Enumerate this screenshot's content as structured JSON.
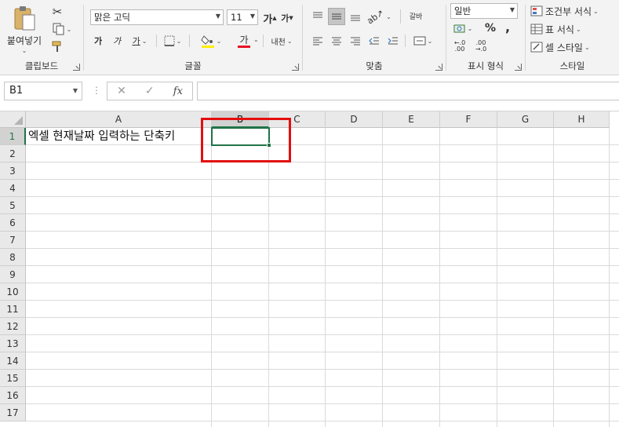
{
  "ribbon": {
    "clipboard": {
      "label": "클립보드",
      "paste_label": "붙여넣기"
    },
    "font": {
      "label": "글꼴",
      "font_name": "맑은 고딕",
      "font_size": "11",
      "grow_label": "가",
      "shrink_label": "가",
      "bold_label": "가",
      "italic_label": "가",
      "underline_label": "가",
      "font_color_label": "가",
      "phonetic_label": "내천",
      "font_color": "#e81123",
      "highlight_color": "#ffef00"
    },
    "alignment": {
      "label": "맞춤",
      "wrap_label": "갈바"
    },
    "number": {
      "label": "표시 형식",
      "format": "일반",
      "percent": "%",
      "comma": ",",
      "inc_decimal": "←.0\n.00",
      "dec_decimal": ".00\n→.0"
    },
    "styles": {
      "label": "스타일",
      "conditional": "조건부 서식",
      "table_format": "표 서식",
      "cell_styles": "셀 스타일"
    }
  },
  "formula_bar": {
    "name_box": "B1",
    "fx": "fx",
    "cancel": "✕",
    "enter": "✓",
    "value": ""
  },
  "sheet": {
    "columns": [
      "A",
      "B",
      "C",
      "D",
      "E",
      "F",
      "G",
      "H"
    ],
    "rows": [
      "1",
      "2",
      "3",
      "4",
      "5",
      "6",
      "7",
      "8",
      "9",
      "10",
      "11",
      "12",
      "13",
      "14",
      "15",
      "16",
      "17"
    ],
    "active_column": "B",
    "active_row": "1",
    "cell_a1": "엑셀 현재날짜 입력하는 단축키"
  },
  "colors": {
    "accent": "#217346",
    "highlight_box": "#e30f0f"
  }
}
